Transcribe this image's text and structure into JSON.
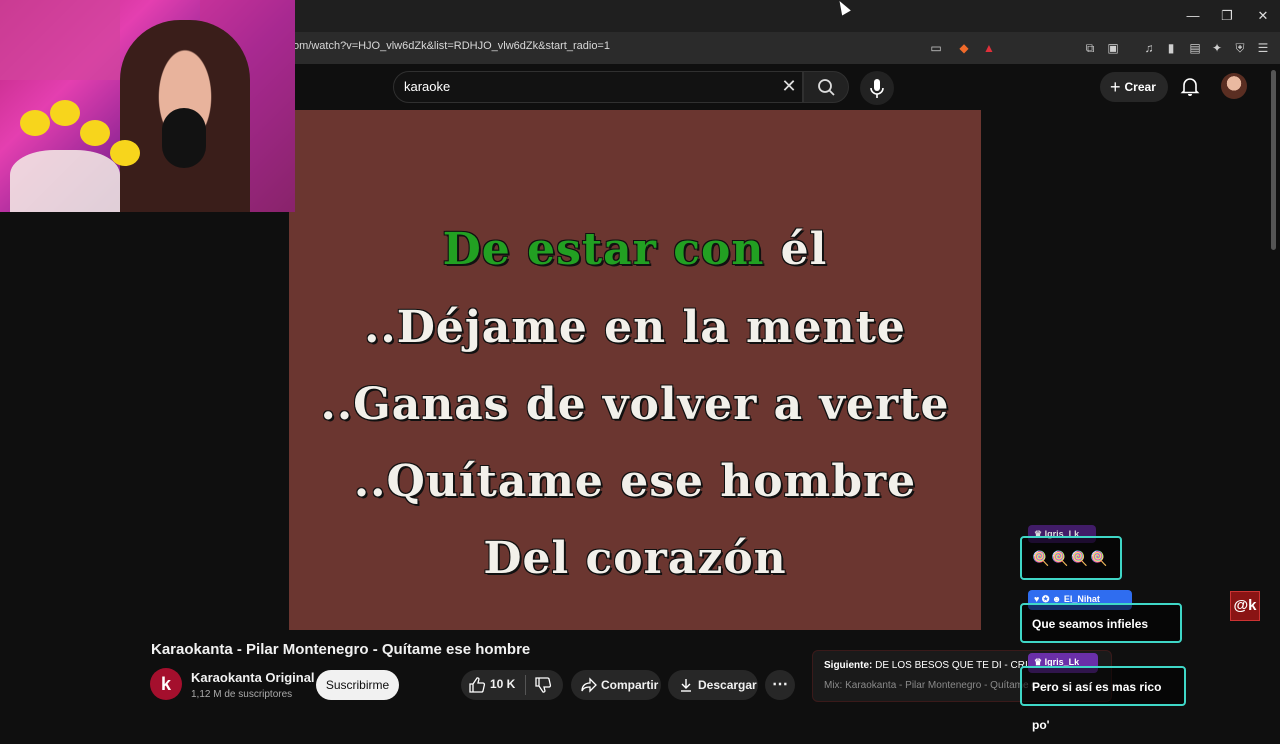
{
  "browser": {
    "url": "om/watch?v=HJO_vlw6dZk&list=RDHJO_vlw6dZk&start_radio=1",
    "window_controls": {
      "minimize": "—",
      "restore": "❐",
      "close": "✕"
    }
  },
  "header": {
    "search_value": "karaoke",
    "create_label": "Crear"
  },
  "video": {
    "lyrics": [
      {
        "highlighted": "De estar con",
        "rest": " él"
      },
      {
        "highlighted": "",
        "rest": "..Déjame en la mente"
      },
      {
        "highlighted": "",
        "rest": "..Ganas de volver a verte"
      },
      {
        "highlighted": "",
        "rest": "..Quítame ese hombre"
      },
      {
        "highlighted": "",
        "rest": "Del corazón"
      }
    ],
    "background_color": "#6b3630",
    "highlight_color": "#22a022"
  },
  "info": {
    "title": "Karaokanta - Pilar Montenegro - Quítame ese hombre",
    "channel_name": "Karaokanta Original",
    "channel_subs": "1,12 M de suscriptores",
    "channel_initial": "k",
    "subscribe_label": "Suscribirme",
    "like_count": "10 K",
    "share_label": "Compartir",
    "download_label": "Descargar"
  },
  "next": {
    "prefix": "Siguiente:",
    "title": "DE LOS BESOS QUE TE DI - CRI",
    "subtitle": "Mix: Karaokanta - Pilar Montenegro - Quítame ese h"
  },
  "chat": [
    {
      "user": "Igris_Lk",
      "message": "🍭🍭🍭🍭",
      "user_color": "#6a2fa8"
    },
    {
      "user": "El_Nihat",
      "message": "Que seamos infieles dice",
      "user_color": "#2f6df0"
    },
    {
      "user": "Igris_Lk",
      "message": "Pero si así es mas rico po'",
      "user_color": "#6a2fa8"
    }
  ],
  "overlay_logo": "@k"
}
